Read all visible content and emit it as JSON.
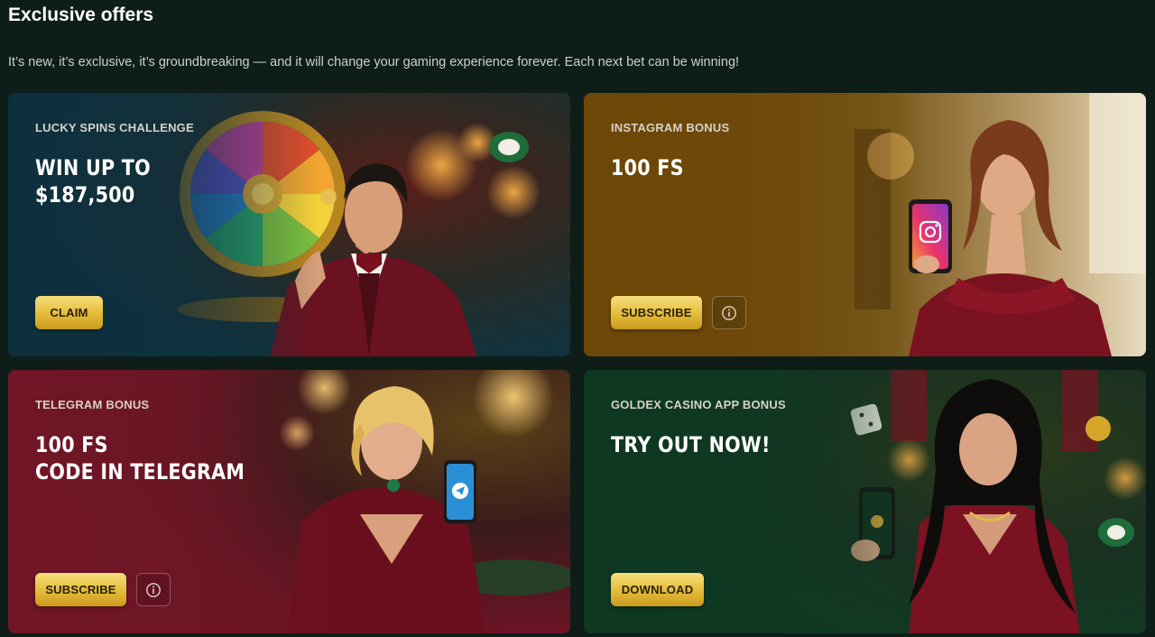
{
  "header": {
    "title": "Exclusive offers",
    "subtitle": "It’s new, it’s exclusive, it’s groundbreaking — and it will change your gaming experience forever. Each next bet can be winning!"
  },
  "offers": [
    {
      "label": "LUCKY SPINS CHALLENGE",
      "headline": [
        "WIN UP TO",
        "$187,500"
      ],
      "button": "CLAIM",
      "has_info": false,
      "theme": "#123845"
    },
    {
      "label": "INSTAGRAM BONUS",
      "headline": [
        "100 FS"
      ],
      "button": "SUBSCRIBE",
      "has_info": true,
      "theme": "#6e4a0b"
    },
    {
      "label": "TELEGRAM BONUS",
      "headline": [
        "100 FS",
        "CODE IN TELEGRAM"
      ],
      "button": "SUBSCRIBE",
      "has_info": true,
      "theme": "#5b1622"
    },
    {
      "label": "GOLDEX CASINO APP BONUS",
      "headline": [
        "TRY OUT NOW!"
      ],
      "button": "DOWNLOAD",
      "has_info": false,
      "theme": "#0f3a22"
    }
  ],
  "icons": {
    "info": "info-icon",
    "instagram": "instagram-icon",
    "telegram": "telegram-icon"
  },
  "colors": {
    "background": "#0f1d18",
    "button_gold": "#e4bb39",
    "button_text": "#2a2104"
  }
}
